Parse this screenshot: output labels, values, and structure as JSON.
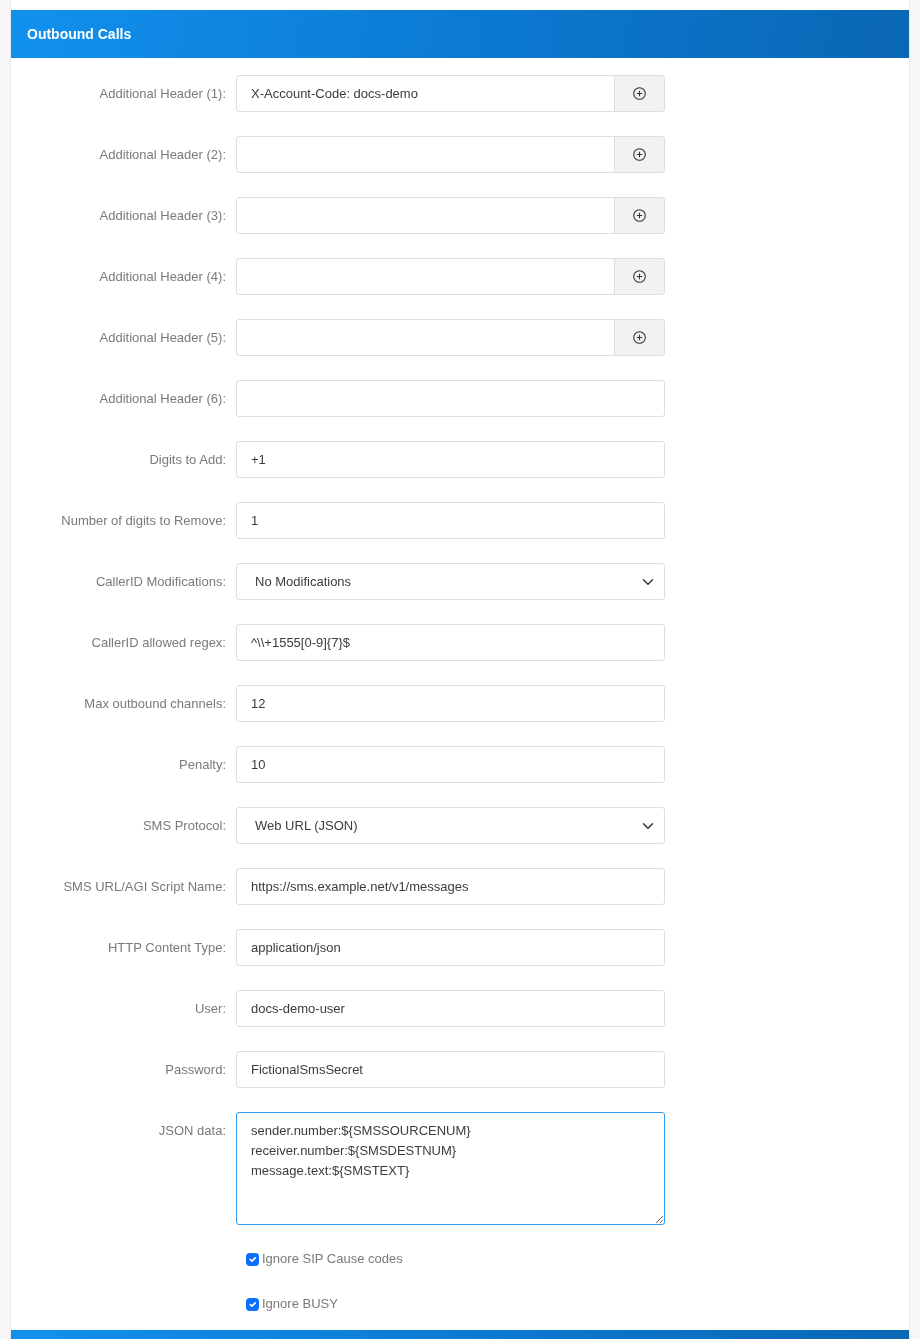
{
  "panel": {
    "title": "Outbound Calls"
  },
  "fields": [
    {
      "label": "Additional Header (1):",
      "kind": "addable",
      "value": "X-Account-Code: docs-demo",
      "focused": false
    },
    {
      "label": "Additional Header (2):",
      "kind": "addable",
      "focused": false
    },
    {
      "label": "Additional Header (3):",
      "kind": "addable",
      "focused": false
    },
    {
      "label": "Additional Header (4):",
      "kind": "addable",
      "focused": false
    },
    {
      "label": "Additional Header (5):",
      "kind": "addable",
      "focused": false
    },
    {
      "label": "Additional Header (6):",
      "kind": "text",
      "focused": false
    },
    {
      "label": "Digits to Add:",
      "kind": "text",
      "value": "+1",
      "focused": false
    },
    {
      "label": "Number of digits to Remove:",
      "kind": "text",
      "value": "1",
      "focused": false
    },
    {
      "label": "CallerID Modifications:",
      "kind": "select",
      "value": "No Modifications",
      "focused": false
    },
    {
      "label": "CallerID allowed regex:",
      "kind": "text",
      "value": "^\\\\+1555[0-9]{7}$",
      "focused": false
    },
    {
      "label": "Max outbound channels:",
      "kind": "text",
      "value": "12",
      "focused": false
    },
    {
      "label": "Penalty:",
      "kind": "text",
      "value": "10",
      "focused": false
    },
    {
      "label": "SMS Protocol:",
      "kind": "select",
      "value": "Web URL (JSON)",
      "focused": false
    },
    {
      "label": "SMS URL/AGI Script Name:",
      "kind": "text",
      "value": "https://sms.example.net/v1/messages",
      "focused": false
    },
    {
      "label": "HTTP Content Type:",
      "kind": "text",
      "value": "application/json",
      "focused": false
    },
    {
      "label": "User:",
      "kind": "text",
      "value": "docs-demo-user",
      "focused": false
    },
    {
      "label": "Password:",
      "kind": "text",
      "value": "FictionalSmsSecret",
      "focused": false
    },
    {
      "label": "JSON data:",
      "kind": "textarea",
      "value": "sender.number:${SMSSOURCENUM}\nreceiver.number:${SMSDESTNUM}\nmessage.text:${SMSTEXT}",
      "focused": true
    }
  ],
  "checkboxes": [
    {
      "label": "Ignore SIP Cause codes",
      "checked": true
    },
    {
      "label": "Ignore BUSY",
      "checked": true
    }
  ]
}
